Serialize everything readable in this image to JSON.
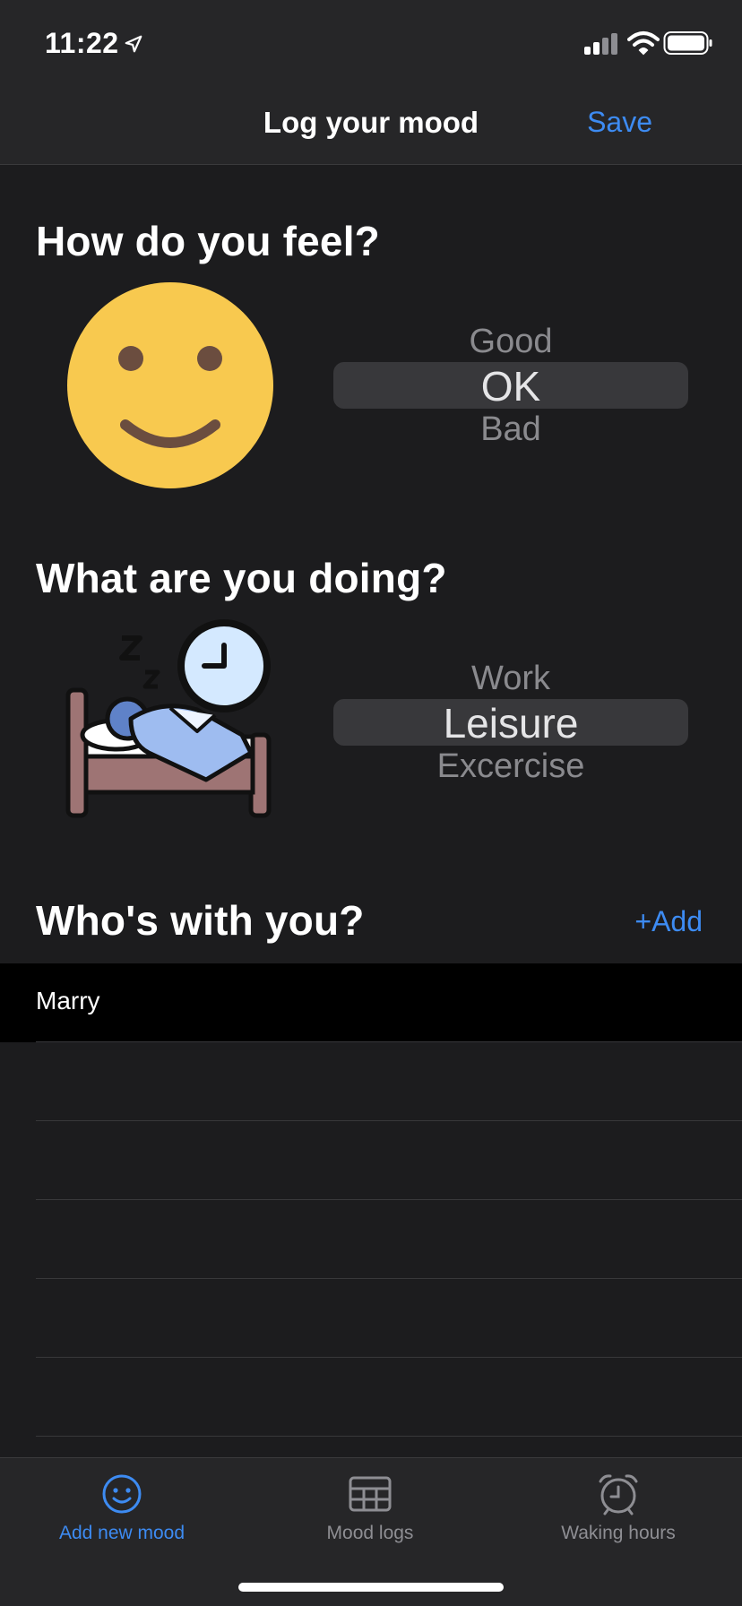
{
  "status_bar": {
    "time": "11:22"
  },
  "nav": {
    "title": "Log your mood",
    "save_label": "Save"
  },
  "feel": {
    "title": "How do you feel?",
    "options": [
      "Good",
      "OK",
      "Bad"
    ],
    "selected": "OK"
  },
  "doing": {
    "title": "What are you doing?",
    "options": [
      "Work",
      "Leisure",
      "Excercise"
    ],
    "selected": "Leisure"
  },
  "who": {
    "title": "Who's with you?",
    "add_label": "+Add",
    "people": [
      "Marry"
    ]
  },
  "tab_bar": {
    "tabs": [
      {
        "label": "Add new mood",
        "icon": "smiley-icon",
        "active": true
      },
      {
        "label": "Mood logs",
        "icon": "table-icon",
        "active": false
      },
      {
        "label": "Waking hours",
        "icon": "alarm-clock-icon",
        "active": false
      }
    ]
  },
  "colors": {
    "accent": "#3d8bf2",
    "background": "#1c1c1e",
    "bar": "#262628",
    "smiley": "#f8c94f"
  }
}
